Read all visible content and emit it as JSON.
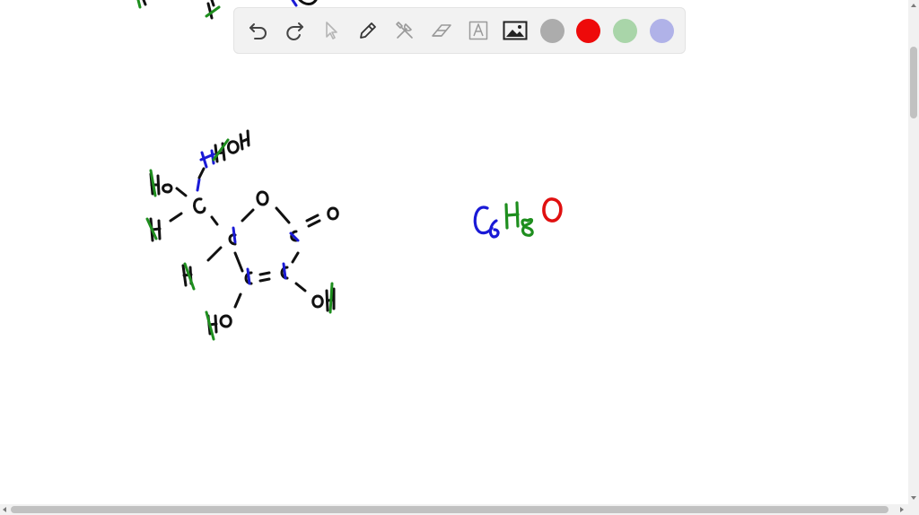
{
  "canvas": {
    "formula_parts": [
      "C",
      "6",
      "H",
      "8",
      "O"
    ],
    "structure_atoms": [
      "Ho",
      "H",
      "H",
      "Ho",
      "OH",
      "O",
      "O",
      "C"
    ]
  },
  "toolbar": {
    "tools": [
      "undo-icon",
      "redo-icon",
      "pointer-icon",
      "pen-icon",
      "tools-icon",
      "eraser-icon",
      "text-icon",
      "image-icon"
    ],
    "colors": {
      "gray": "#acacac",
      "red": "#ee0a0a",
      "green": "#a9d5a9",
      "purple": "#b0b2e8"
    }
  },
  "ink_colors": {
    "black": "#111111",
    "blue": "#1a1ad6",
    "green": "#1e8e1e",
    "red": "#e01010"
  }
}
